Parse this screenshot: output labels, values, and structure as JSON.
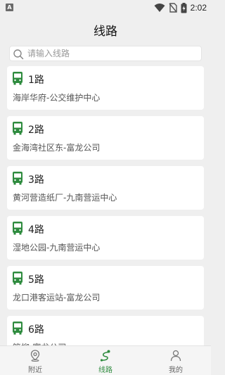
{
  "status": {
    "badge": "A",
    "time": "2:02"
  },
  "page": {
    "title": "线路"
  },
  "search": {
    "placeholder": "请输入线路"
  },
  "routes": [
    {
      "name": "1路",
      "desc": "海岸华府-公交维护中心"
    },
    {
      "name": "2路",
      "desc": "金海湾社区东-富龙公司"
    },
    {
      "name": "3路",
      "desc": "黄河营造纸厂-九南营运中心"
    },
    {
      "name": "4路",
      "desc": "湿地公园-九南营运中心"
    },
    {
      "name": "5路",
      "desc": "龙口港客运站-富龙公司"
    },
    {
      "name": "6路",
      "desc": "管柳-富龙公司"
    }
  ],
  "tabbar": {
    "items": [
      {
        "label": "附近",
        "icon": "location-pin-icon",
        "active": false
      },
      {
        "label": "线路",
        "icon": "route-icon",
        "active": true
      },
      {
        "label": "我的",
        "icon": "person-icon",
        "active": false
      }
    ]
  },
  "colors": {
    "accent": "#2e8b3e",
    "background": "#efefef",
    "card": "#ffffff"
  }
}
